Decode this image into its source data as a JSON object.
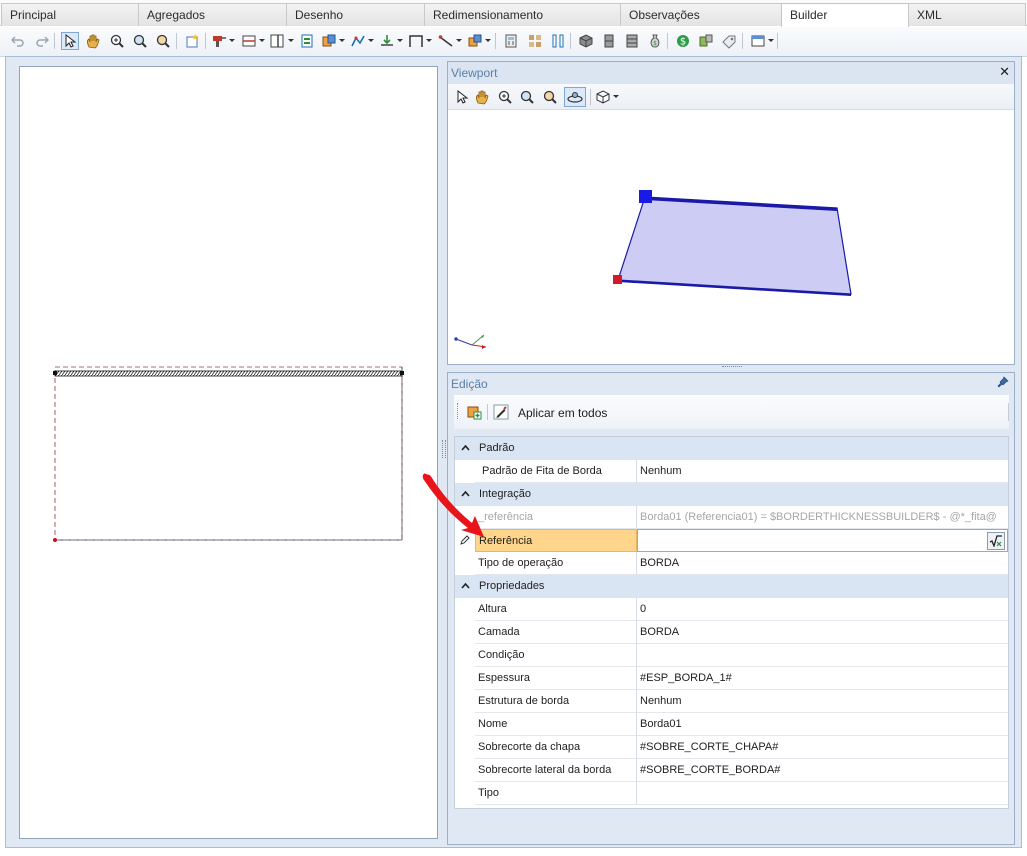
{
  "tabs": [
    {
      "label": "Principal",
      "active": false
    },
    {
      "label": "Agregados",
      "active": false
    },
    {
      "label": "Desenho",
      "active": false
    },
    {
      "label": "Redimensionamento",
      "active": false
    },
    {
      "label": "Observações",
      "active": false
    },
    {
      "label": "Builder",
      "active": true
    },
    {
      "label": "XML",
      "active": false
    }
  ],
  "toolbar_icons": [
    "undo-icon",
    "redo-icon",
    "select-icon",
    "pan-icon",
    "zoom-extents-icon",
    "zoom-in-icon",
    "zoom-window-icon",
    "new-item-icon",
    "drill-icon",
    "panel-split-icon",
    "vertical-split-icon",
    "insert-icon",
    "group-icon",
    "route-icon",
    "dimension-icon",
    "frame-icon",
    "line-icon",
    "material-icon",
    "calculator-icon",
    "texture-icon",
    "column-icon",
    "box-icon",
    "slot-icon",
    "drawer-icon",
    "money-bag-icon",
    "cost-icon",
    "hardware-icon",
    "tag-icon",
    "window-icon"
  ],
  "viewport": {
    "title": "Viewport",
    "shape_fill": "#ccccf5",
    "shape_stroke": "#1a1aa6",
    "marker_blue": "#1a1ae6",
    "marker_red": "#d41a2a"
  },
  "edicao": {
    "title": "Edição",
    "apply_label": "Aplicar em todos",
    "selected_highlight": "#ffd58c"
  },
  "properties": [
    {
      "kind": "category",
      "label": "Padrão"
    },
    {
      "kind": "prop",
      "label": "Padrão de Fita de Borda",
      "value": "Nenhum"
    },
    {
      "kind": "category",
      "label": "Integração"
    },
    {
      "kind": "prop",
      "label": "_referência",
      "value": "Borda01 (Referencia01) = $BORDERTHICKNESSBUILDER$ - @*_fita@",
      "readonly": true
    },
    {
      "kind": "prop",
      "label": "Referência",
      "value": "",
      "selected": true
    },
    {
      "kind": "prop",
      "label": "Tipo de operação",
      "value": "BORDA"
    },
    {
      "kind": "category",
      "label": "Propriedades"
    },
    {
      "kind": "prop",
      "label": "Altura",
      "value": "0"
    },
    {
      "kind": "prop",
      "label": "Camada",
      "value": "BORDA"
    },
    {
      "kind": "prop",
      "label": "Condição",
      "value": ""
    },
    {
      "kind": "prop",
      "label": "Espessura",
      "value": "#ESP_BORDA_1#"
    },
    {
      "kind": "prop",
      "label": "Estrutura de borda",
      "value": "Nenhum"
    },
    {
      "kind": "prop",
      "label": "Nome",
      "value": "Borda01"
    },
    {
      "kind": "prop",
      "label": "Sobrecorte da chapa",
      "value": "#SOBRE_CORTE_CHAPA#"
    },
    {
      "kind": "prop",
      "label": "Sobrecorte lateral da borda",
      "value": "#SOBRE_CORTE_BORDA#"
    },
    {
      "kind": "prop",
      "label": "Tipo",
      "value": ""
    }
  ],
  "annotation_arrow_color": "#e8141a"
}
